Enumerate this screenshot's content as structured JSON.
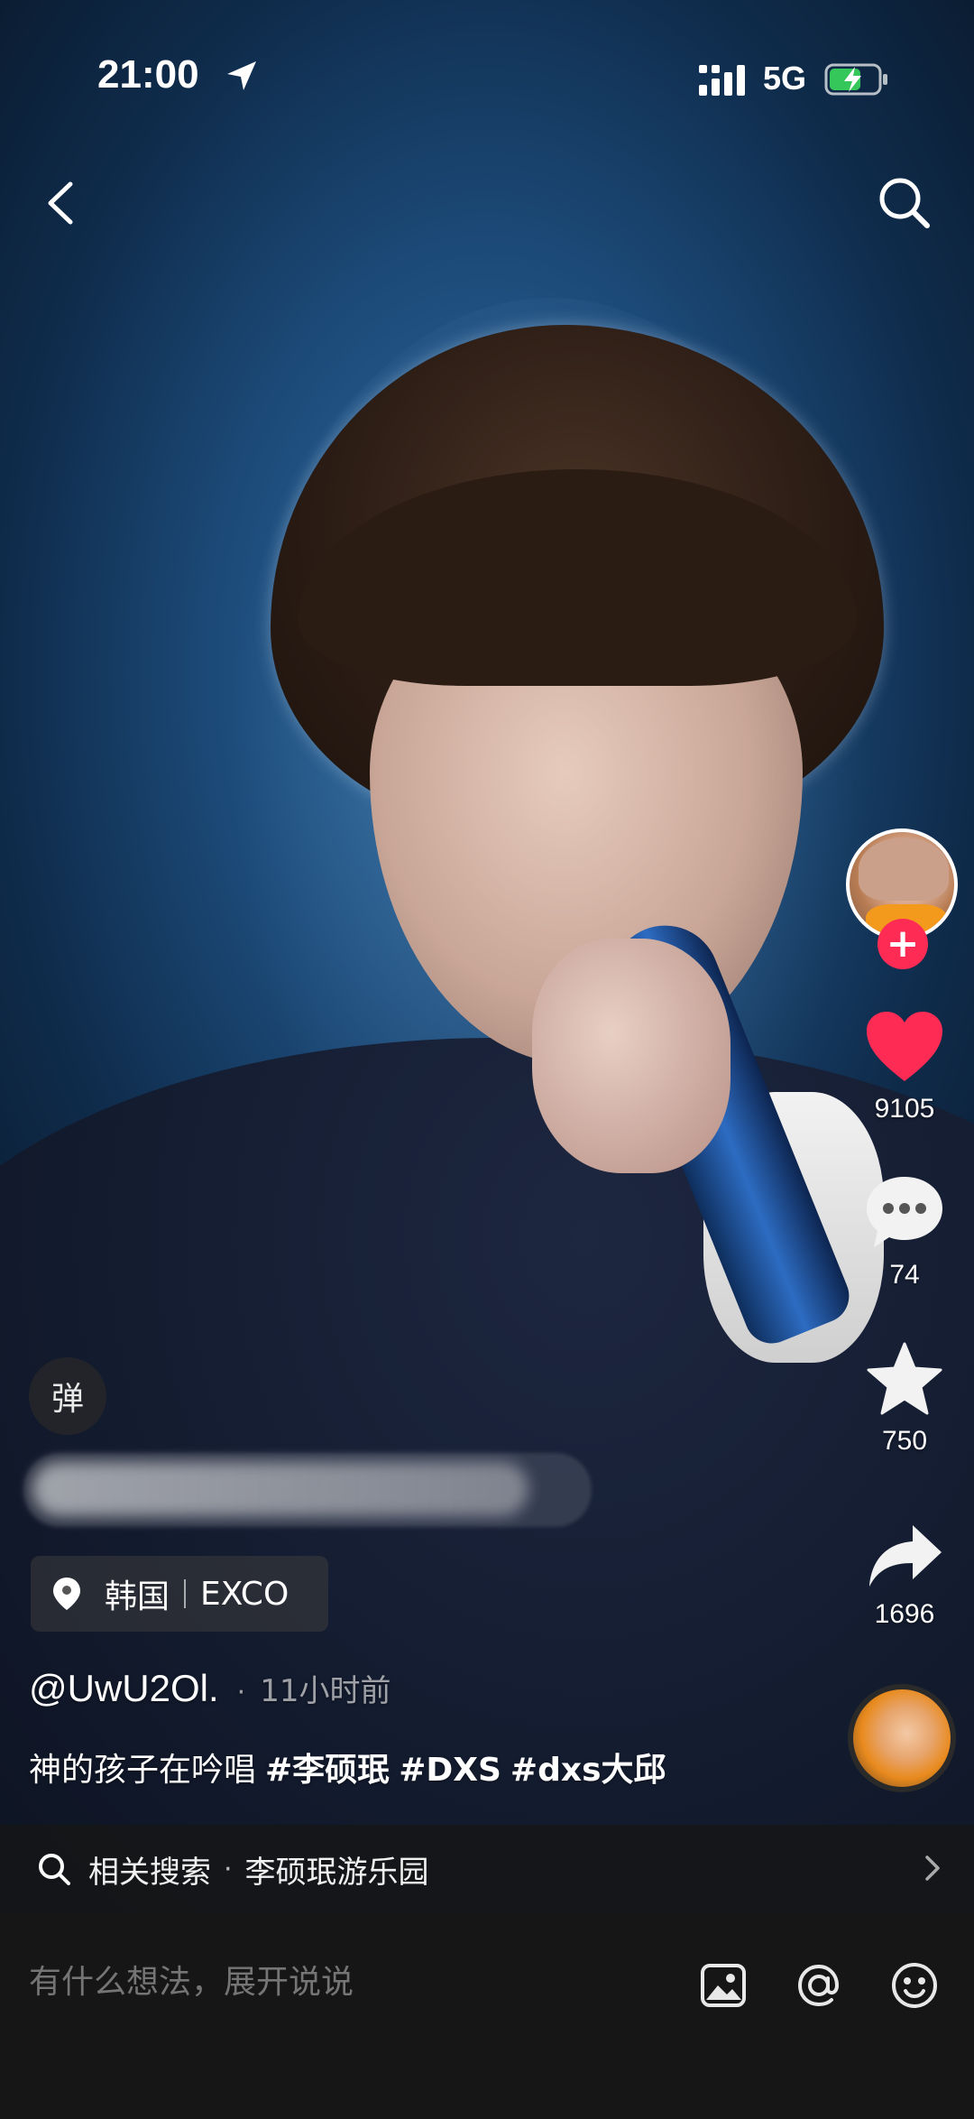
{
  "status_bar": {
    "time": "21:00",
    "network": "5G"
  },
  "nav": {
    "back_icon": "chevron-left-icon",
    "search_icon": "search-icon"
  },
  "creator": {
    "follow_label": "+"
  },
  "actions": {
    "likes": "9105",
    "comments": "74",
    "favorites": "750",
    "shares": "1696"
  },
  "danmaku": {
    "label": "弹"
  },
  "location": {
    "country": "韩国",
    "place": "EXCO"
  },
  "post": {
    "author": "@UwU2Ol.",
    "separator": "·",
    "time_ago": "11小时前",
    "caption": "神的孩子在吟唱",
    "hashtags": [
      "#李硕珉",
      "#DXS",
      "#dxs大邱"
    ]
  },
  "related_search": {
    "label": "相关搜索",
    "separator": "·",
    "query": "李硕珉游乐园"
  },
  "comment_bar": {
    "placeholder": "有什么想法，展开说说"
  },
  "colors": {
    "like_red": "#fe2c55",
    "battery_green": "#35c759",
    "bar_bg": "#161616"
  }
}
